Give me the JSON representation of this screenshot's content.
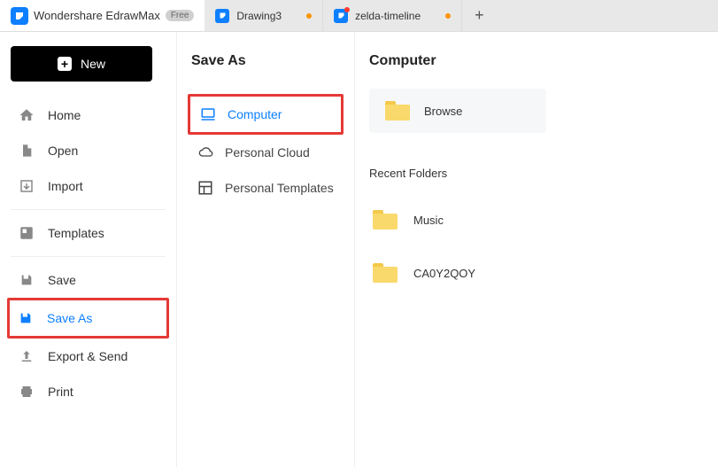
{
  "app": {
    "name": "Wondershare EdrawMax",
    "badge": "Free"
  },
  "tabs": [
    {
      "label": "Drawing3",
      "modified": true
    },
    {
      "label": "zelda-timeline",
      "modified": true
    }
  ],
  "sidebar": {
    "new_label": "New",
    "items": {
      "home": "Home",
      "open": "Open",
      "import": "Import",
      "templates": "Templates",
      "save": "Save",
      "save_as": "Save As",
      "export_send": "Export & Send",
      "print": "Print"
    }
  },
  "save_as": {
    "title": "Save As",
    "targets": {
      "computer": "Computer",
      "personal_cloud": "Personal Cloud",
      "personal_templates": "Personal Templates"
    }
  },
  "right": {
    "title": "Computer",
    "browse_label": "Browse",
    "recent_label": "Recent Folders",
    "recent": [
      {
        "name": "Music"
      },
      {
        "name": "CA0Y2QOY"
      }
    ]
  }
}
